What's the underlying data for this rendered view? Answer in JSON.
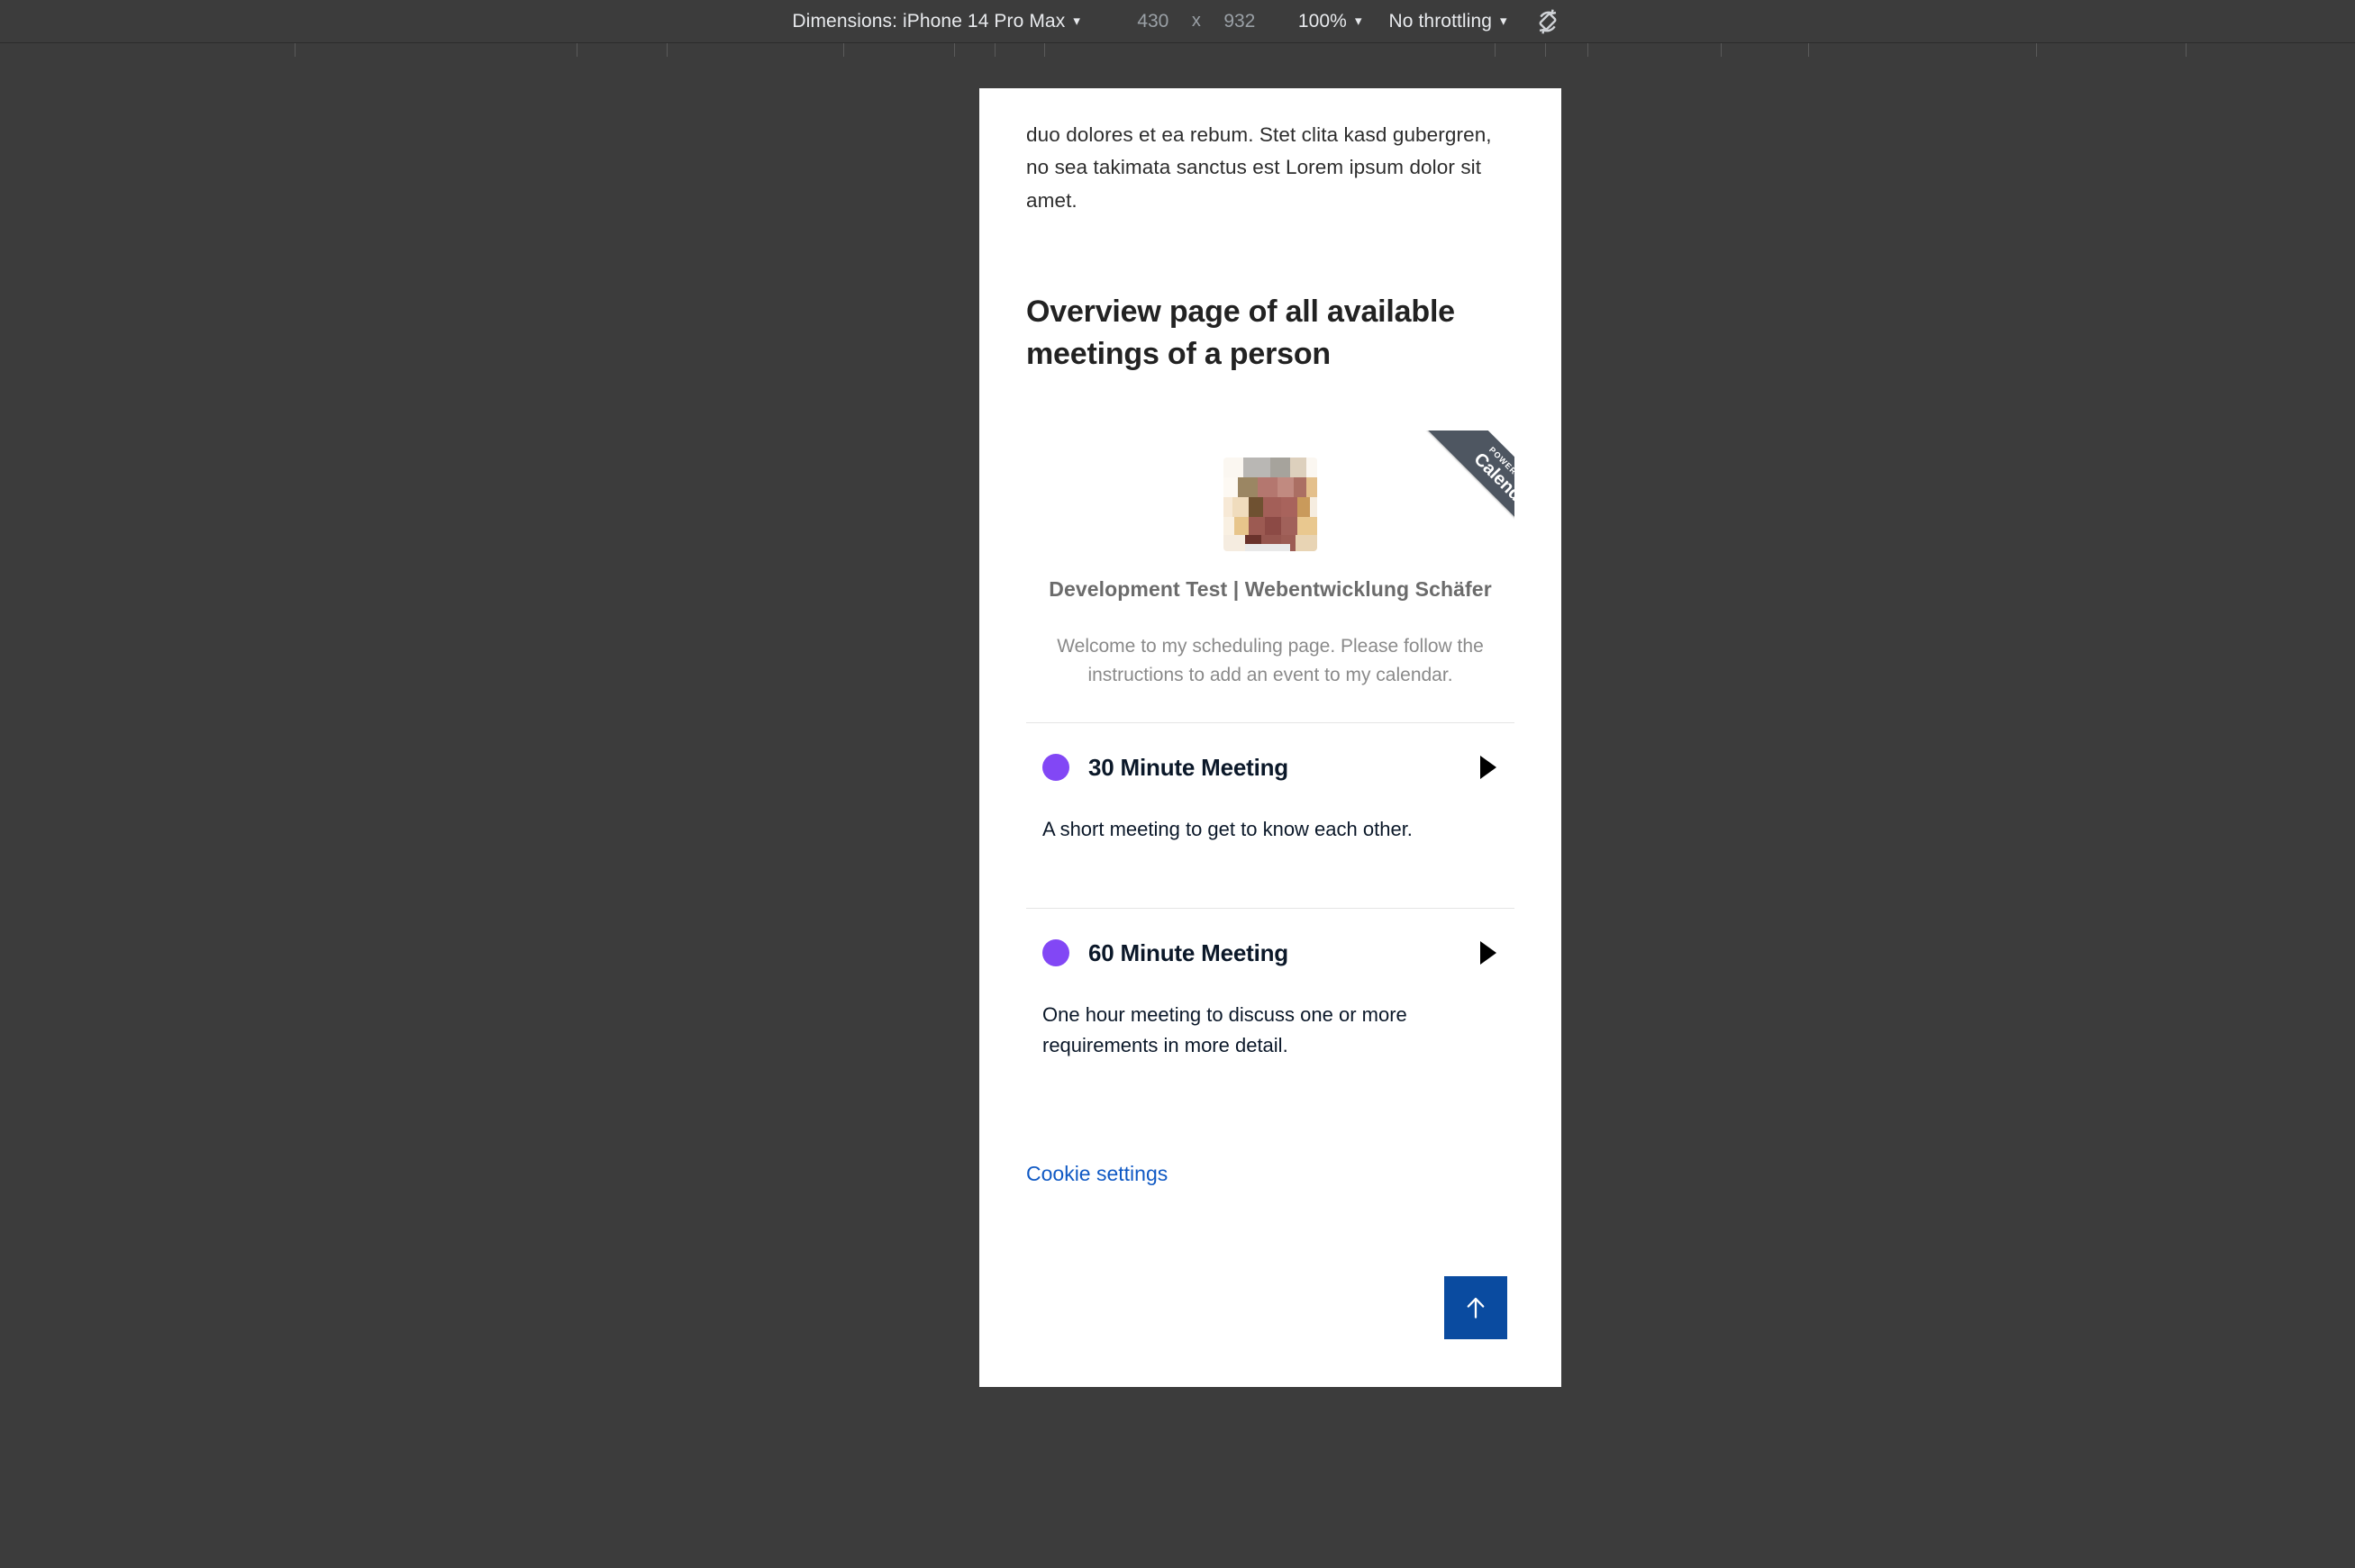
{
  "devtools": {
    "dimensions_label": "Dimensions: iPhone 14 Pro Max",
    "device_caret": "▾",
    "width_value": "430",
    "times_symbol": "x",
    "height_value": "932",
    "zoom_value": "100%",
    "zoom_caret": "▾",
    "throttling_value": "No throttling",
    "throttling_caret": "▾",
    "rotate_icon_name": "rotate-device-icon"
  },
  "page": {
    "lorem_tail": "duo dolores et ea rebum. Stet clita kasd gubergren, no sea takimata sanctus est Lorem ipsum dolor sit amet.",
    "heading": "Overview page of all available meetings of a person",
    "cookie_settings_label": "Cookie settings"
  },
  "calendly": {
    "ribbon_top": "POWERED BY",
    "ribbon_brand": "Calendly",
    "host_name": "Development Test | Webentwicklung Schäfer",
    "welcome_text": "Welcome to my scheduling page. Please follow the instructions to add an event to my calendar.",
    "accent_color": "#8247f5",
    "ribbon_color": "#4e5661",
    "events": [
      {
        "title": "30 Minute Meeting",
        "description": "A short meeting to get to know each other."
      },
      {
        "title": "60 Minute Meeting",
        "description": "One hour meeting to discuss one or more requirements in more detail."
      }
    ]
  },
  "scroll_top": {
    "icon_name": "arrow-up-icon",
    "color": "#0a4ba0"
  }
}
